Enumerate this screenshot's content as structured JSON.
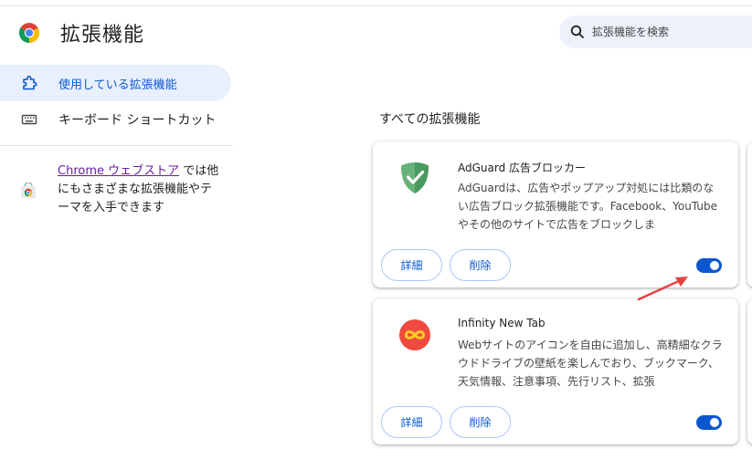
{
  "header": {
    "title": "拡張機能",
    "search_placeholder": "拡張機能を検索"
  },
  "sidebar": {
    "items": [
      {
        "label": "使用している拡張機能",
        "icon": "puzzle-icon",
        "active": true
      },
      {
        "label": "キーボード ショートカット",
        "icon": "keyboard-icon",
        "active": false
      }
    ],
    "store_link": "Chrome ウェブストア",
    "store_text": " では他にもさまざまな拡張機能やテーマを入手できます"
  },
  "main": {
    "section_title": "すべての拡張機能",
    "extensions": [
      {
        "name": "AdGuard 広告ブロッカー",
        "description": "AdGuardは、広告やポップアップ対処には比類のない広告ブロック拡張機能です。Facebook、YouTubeやその他のサイトで広告をブロックしま",
        "details_label": "詳細",
        "remove_label": "削除",
        "enabled": true,
        "icon": "adguard-shield-icon"
      },
      {
        "name": "Infinity New Tab",
        "description": "Webサイトのアイコンを自由に追加し、高精細なクラウドドライブの壁紙を楽しんでおり、ブックマーク、天気情報、注意事項、先行リスト、拡張",
        "details_label": "詳細",
        "remove_label": "削除",
        "enabled": true,
        "icon": "infinity-icon"
      }
    ]
  },
  "colors": {
    "accent": "#0b57d0",
    "active_nav_bg": "#e8f0fe",
    "search_bg": "#edf2fa",
    "annotation_arrow": "#e8423f"
  }
}
